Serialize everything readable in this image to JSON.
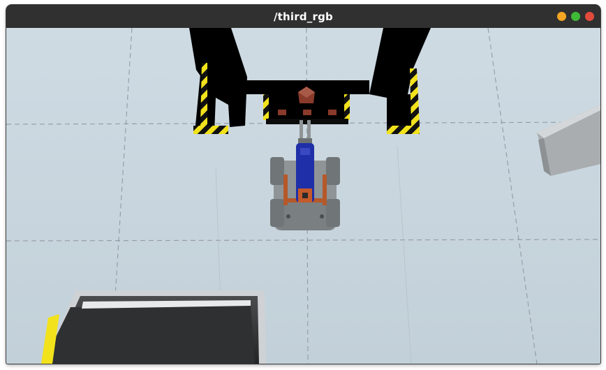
{
  "window": {
    "title": "/third_rgb",
    "controls": [
      {
        "name": "minimize",
        "color": "#f5a623"
      },
      {
        "name": "maximize",
        "color": "#3fba36"
      },
      {
        "name": "close",
        "color": "#e24a3b"
      }
    ]
  },
  "colors": {
    "floor": "#c9d6df",
    "floor_seam": "#8e9aa3",
    "gantry": "#000000",
    "hazard_yellow": "#f2e21c",
    "robot_blue": "#1f2fa8",
    "robot_gray": "#8f9496",
    "robot_orange": "#b5582a",
    "crate": "#8a3a2a",
    "ramp": "#b9bdbf",
    "platform": "#343638"
  }
}
